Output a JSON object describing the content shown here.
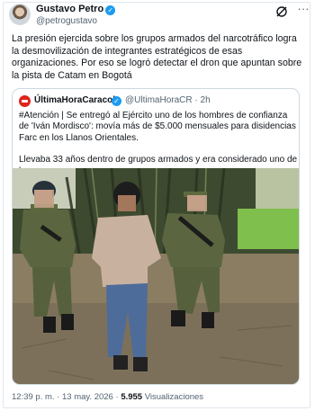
{
  "post": {
    "author_name": "Gustavo Petro",
    "handle": "@petrogustavo",
    "text": "La presión ejercida sobre los grupos armados del narcotráfico logra la desmovilización de integrantes estratégicos de esas organizaciones. Por eso se logró detectar el dron que apuntan sobre la pista de Catam en Bogotá",
    "time": "12:39 p. m.",
    "separator": "·",
    "date": "13 may. 2026",
    "views_count": "5.955",
    "views_label": "Visualizaciones"
  },
  "quote": {
    "author_name": "ÚltimaHoraCaracol",
    "handle": "@UltimaHoraCR",
    "separator": "·",
    "age": "2h",
    "text_1": "#Atención | Se entregó al Ejército uno de los hombres de confianza de 'Iván Mordisco': movía más de $5.000 mensuales para disidencias Farc en los Llanos Orientales.",
    "text_2": "Llevaba 33 años dentro de grupos armados y era considerado uno de los ..."
  },
  "icons": {
    "verified": "verified-check-icon",
    "grok": "grok-icon",
    "more": "more-options-icon",
    "quote_logo": "ultimahoracaracol-logo"
  },
  "colors": {
    "verified": "#1d9bf0",
    "secondary_text": "#536471",
    "quote_logo": "#e0241a"
  }
}
